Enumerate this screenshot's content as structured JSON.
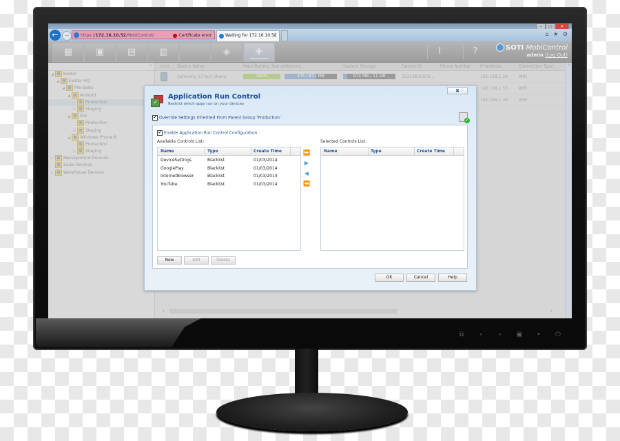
{
  "browser": {
    "url_prefix": "https://",
    "url_host": "172.16.10.52",
    "url_path": "/MobiControl/",
    "certificate_error": "Certificate error",
    "tab_title": "Waiting for 172.16.10.52",
    "tab_close": "×",
    "back_icon": "←",
    "forward_icon": "→",
    "window_controls": [
      "–",
      "□",
      "×"
    ],
    "toolbar_icons": "⌂ ★ ⚙"
  },
  "app": {
    "brand_bold": "SOTI",
    "brand_italic": "MobiControl",
    "user": "admin",
    "logout": "(Log Out)",
    "nav_tabs": [
      {
        "icon": "▦",
        "name": "all-devices"
      },
      {
        "icon": "▣",
        "name": "devices"
      },
      {
        "icon": "▤",
        "name": "desktops"
      },
      {
        "icon": "▥",
        "name": "windows"
      },
      {
        "icon": "",
        "name": "apple"
      },
      {
        "icon": "◈",
        "name": "android"
      },
      {
        "icon": "✚",
        "name": "android-plus"
      }
    ],
    "reports_icon": "⌇",
    "help_icon": "?"
  },
  "tree": {
    "collapse": "«",
    "items": [
      {
        "label": "Exotor",
        "level": 0,
        "arrow": "◢",
        "type": "group"
      },
      {
        "label": "Exotor HQ",
        "level": 1,
        "arrow": "◢",
        "type": "group"
      },
      {
        "label": "Pre-Sales",
        "level": 2,
        "arrow": "◢",
        "type": "group"
      },
      {
        "label": "Android",
        "level": 3,
        "arrow": "◢",
        "type": "group"
      },
      {
        "label": "Production",
        "level": 4,
        "arrow": "",
        "type": "group",
        "selected": true
      },
      {
        "label": "Staging",
        "level": 4,
        "arrow": "▷",
        "type": "group"
      },
      {
        "label": "iOS",
        "level": 3,
        "arrow": "◢",
        "type": "group"
      },
      {
        "label": "Production",
        "level": 4,
        "arrow": "",
        "type": "group"
      },
      {
        "label": "Staging",
        "level": 4,
        "arrow": "▷",
        "type": "group"
      },
      {
        "label": "Windows Phone 8",
        "level": 3,
        "arrow": "◢",
        "type": "group"
      },
      {
        "label": "Production",
        "level": 4,
        "arrow": "",
        "type": "group"
      },
      {
        "label": "Staging",
        "level": 4,
        "arrow": "▷",
        "type": "group"
      },
      {
        "label": "Management Devices",
        "level": 0,
        "arrow": "▷",
        "type": "group"
      },
      {
        "label": "Sales Devices",
        "level": 0,
        "arrow": "",
        "type": "group"
      },
      {
        "label": "Warehouse Devices",
        "level": 0,
        "arrow": "▷",
        "type": "group"
      }
    ]
  },
  "grid": {
    "columns": [
      "Icon",
      "Device Name",
      "Main Battery Status",
      "Memory",
      "System Storage",
      "Device ID",
      "Phone Number",
      "IP Address",
      "Connection Type"
    ],
    "rows": [
      {
        "device_name": "Samsung S3 test phone",
        "battery": "100%",
        "memory": "475 / 831 MB",
        "storage": "974 MB / 11 GB",
        "device_id": "35316605878...",
        "phone": "",
        "ip": "192.168.1.29",
        "connection": "WiFi"
      },
      {
        "device_name": "",
        "battery": "",
        "memory": "",
        "storage": "",
        "device_id": "",
        "phone": "",
        "ip": "192.168.1.53",
        "connection": "WiFi"
      },
      {
        "device_name": "",
        "battery": "",
        "memory": "",
        "storage": "",
        "device_id": "",
        "phone": "",
        "ip": "192.168.1.39",
        "connection": "WiFi"
      }
    ],
    "scroll_left": "‹",
    "scroll_right": "›",
    "right_collapse": "«"
  },
  "dialog": {
    "title": "Application Run Control",
    "subtitle": "Restrict which apps run on your devices",
    "close": "✖",
    "override_label": "Override Settings Inherited From Parent Group 'Production'",
    "override_checked": "✔",
    "enable_label": "Enable Application Run Control Configuration",
    "enable_checked": "✔",
    "available_label": "Available Controls List:",
    "selected_label": "Selected Controls List:",
    "columns": [
      "Name",
      "Type",
      "Create Time"
    ],
    "available_rows": [
      {
        "name": "DeviceSettings",
        "type": "Blacklist",
        "time": "01/03/2014"
      },
      {
        "name": "GooglePlay",
        "type": "Blacklist",
        "time": "01/03/2014"
      },
      {
        "name": "InternetBrowser",
        "type": "Blacklist",
        "time": "01/03/2014"
      },
      {
        "name": "YouTube",
        "type": "Blacklist",
        "time": "01/03/2014"
      }
    ],
    "move_buttons": {
      "add_all": "⏩",
      "add": "▶",
      "remove": "◀",
      "remove_all": "⏪"
    },
    "new_button": "New",
    "edit_button": "Edit",
    "delete_button": "Delete",
    "ok_button": "OK",
    "cancel_button": "Cancel",
    "help_button": "Help"
  },
  "monitor": {
    "buttons": [
      "⧉",
      "‹",
      "›",
      "▣",
      "•",
      "⏻"
    ]
  }
}
